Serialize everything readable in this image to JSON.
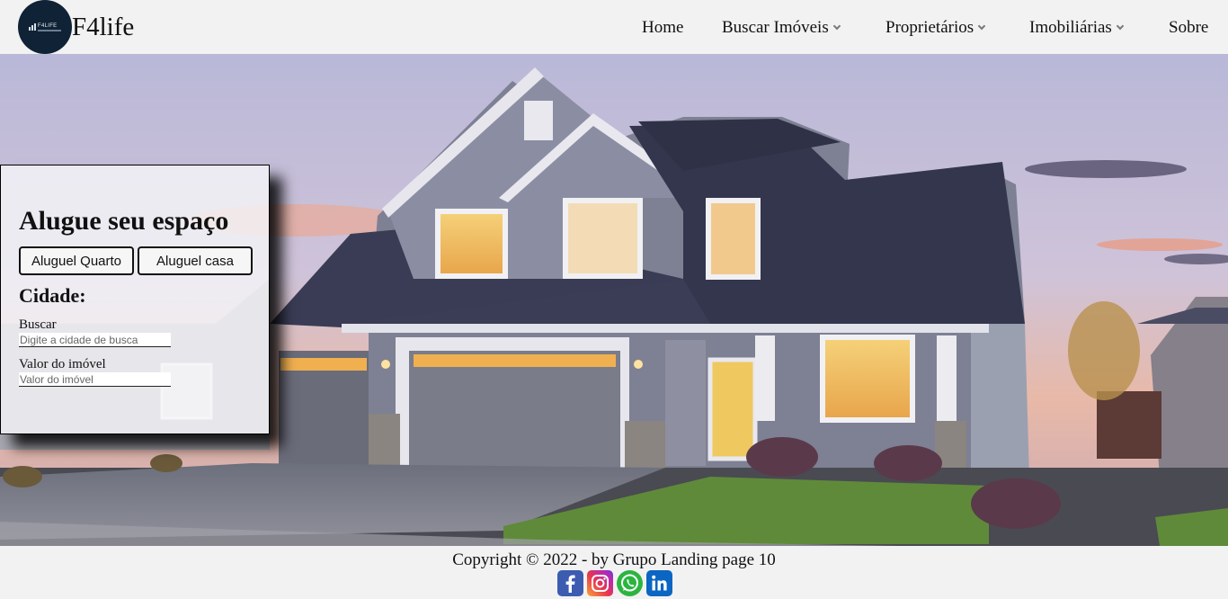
{
  "navbar": {
    "logo_small_text": "F4LIFE",
    "brand": "F4life",
    "items": [
      {
        "label": "Home",
        "has_dropdown": false
      },
      {
        "label": "Buscar Imóveis",
        "has_dropdown": true
      },
      {
        "label": "Proprietários",
        "has_dropdown": true
      },
      {
        "label": "Imobiliárias",
        "has_dropdown": true
      },
      {
        "label": "Sobre",
        "has_dropdown": false
      }
    ]
  },
  "search_card": {
    "title": "Alugue seu espaço",
    "buttons": [
      "Aluguel Quarto",
      "Aluguel casa"
    ],
    "city_heading": "Cidade:",
    "search_label": "Buscar",
    "search_placeholder": "Digite a cidade de busca",
    "value_label": "Valor do imóvel",
    "value_placeholder": "Valor do imóvel"
  },
  "footer": {
    "copyright": "Copyright © 2022 - by Grupo Landing page 10",
    "socials": [
      {
        "name": "facebook-icon",
        "color": "#3b5cb0"
      },
      {
        "name": "instagram-icon",
        "color": "#e8364f"
      },
      {
        "name": "whatsapp-icon",
        "color": "#2bb540"
      },
      {
        "name": "linkedin-icon",
        "color": "#0a66c2"
      }
    ]
  },
  "colors": {
    "page_bg": "#f2f2f2",
    "logo_bg": "#0f2236",
    "text": "#111111"
  }
}
